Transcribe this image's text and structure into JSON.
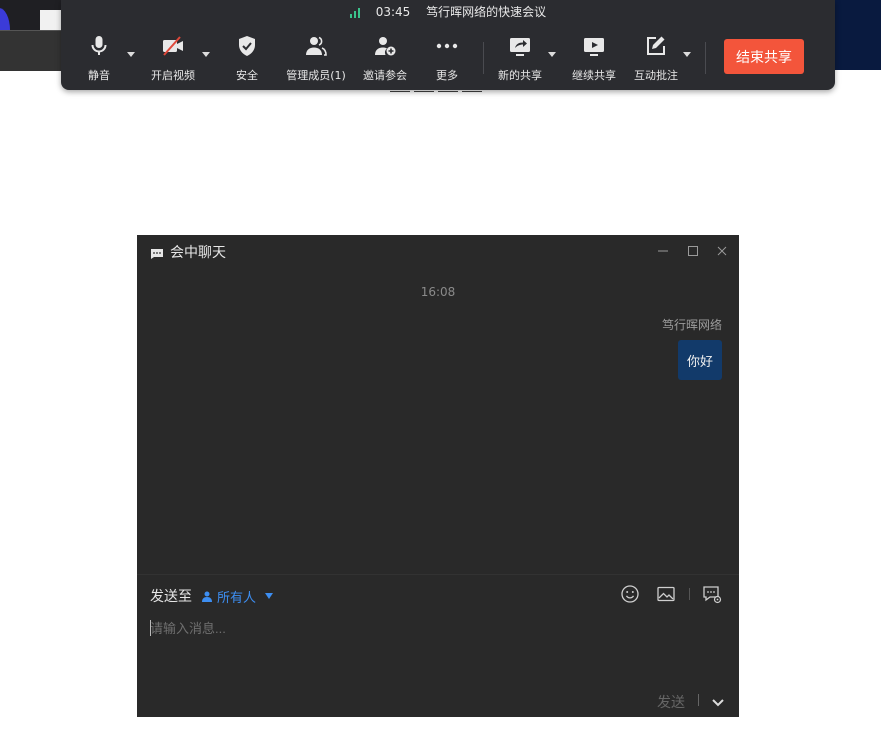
{
  "meeting": {
    "timer": "03:45",
    "title": "笃行晖网络的快速会议",
    "signal_icon": "signal-bars-icon",
    "signal_color": "#3ac28b"
  },
  "toolbar": {
    "mute": {
      "label": "静音",
      "icon": "microphone-icon"
    },
    "video": {
      "label": "开启视频",
      "icon": "camera-off-icon"
    },
    "security": {
      "label": "安全",
      "icon": "shield-check-icon"
    },
    "members": {
      "label": "管理成员(1)",
      "icon": "members-icon"
    },
    "invite": {
      "label": "邀请参会",
      "icon": "add-user-icon"
    },
    "more": {
      "label": "更多",
      "icon": "more-dots-icon"
    },
    "new_share": {
      "label": "新的共享",
      "icon": "share-screen-icon"
    },
    "resume_share": {
      "label": "继续共享",
      "icon": "play-screen-icon"
    },
    "annotate": {
      "label": "互动批注",
      "icon": "annotate-icon"
    },
    "end_share": {
      "label": "结束共享",
      "color": "#f3553b"
    }
  },
  "chat": {
    "title": "会中聊天",
    "message_time": "16:08",
    "messages": [
      {
        "sender": "笃行晖网络",
        "text": "你好",
        "bubble_color": "#123a6a"
      }
    ],
    "send_to_label": "发送至",
    "recipient": "所有人",
    "recipient_color": "#3d8ef2",
    "input_placeholder": "请输入消息...",
    "send_label": "发送"
  }
}
